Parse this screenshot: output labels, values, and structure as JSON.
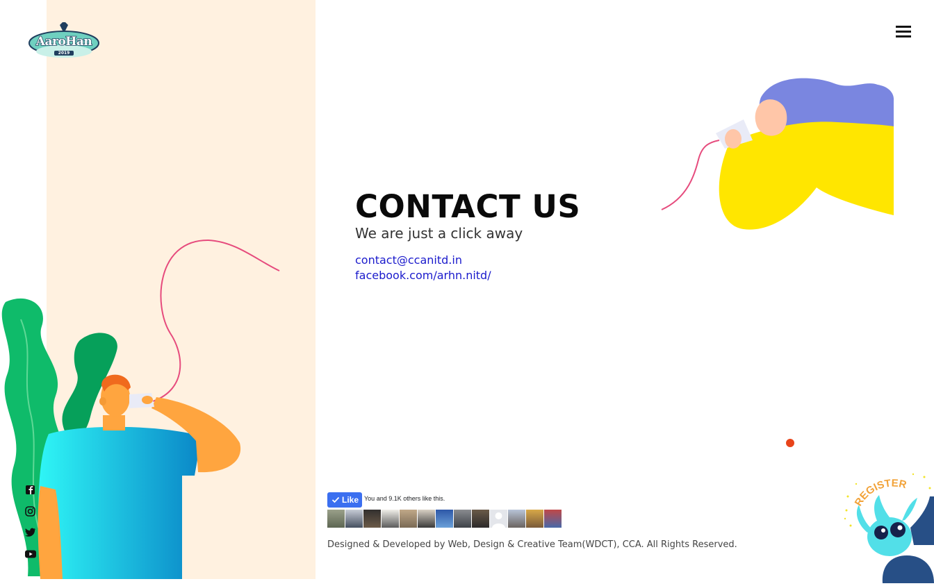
{
  "brand": {
    "logo_text": "AaroHan",
    "logo_year": "2019"
  },
  "header": {
    "menu_icon": "hamburger-menu-icon"
  },
  "contact": {
    "title": "CONTACT US",
    "subtitle": "We are just a click away",
    "email": "contact@ccanitd.in",
    "facebook": "facebook.com/arhn.nitd/"
  },
  "social": [
    "facebook-icon",
    "instagram-icon",
    "twitter-icon",
    "youtube-icon"
  ],
  "fb_like": {
    "button_label": "Like",
    "text": "You and 9.1K others like this.",
    "faces_count_shown": 13
  },
  "footer": {
    "credits": "Designed & Developed by Web, Design & Creative Team(WDCT), CCA. All Rights Reserved."
  },
  "colors": {
    "panel": "#fff1e0",
    "accent_dot": "#e8441a",
    "link": "#1a1acc",
    "like_button": "#3b6ff0"
  }
}
